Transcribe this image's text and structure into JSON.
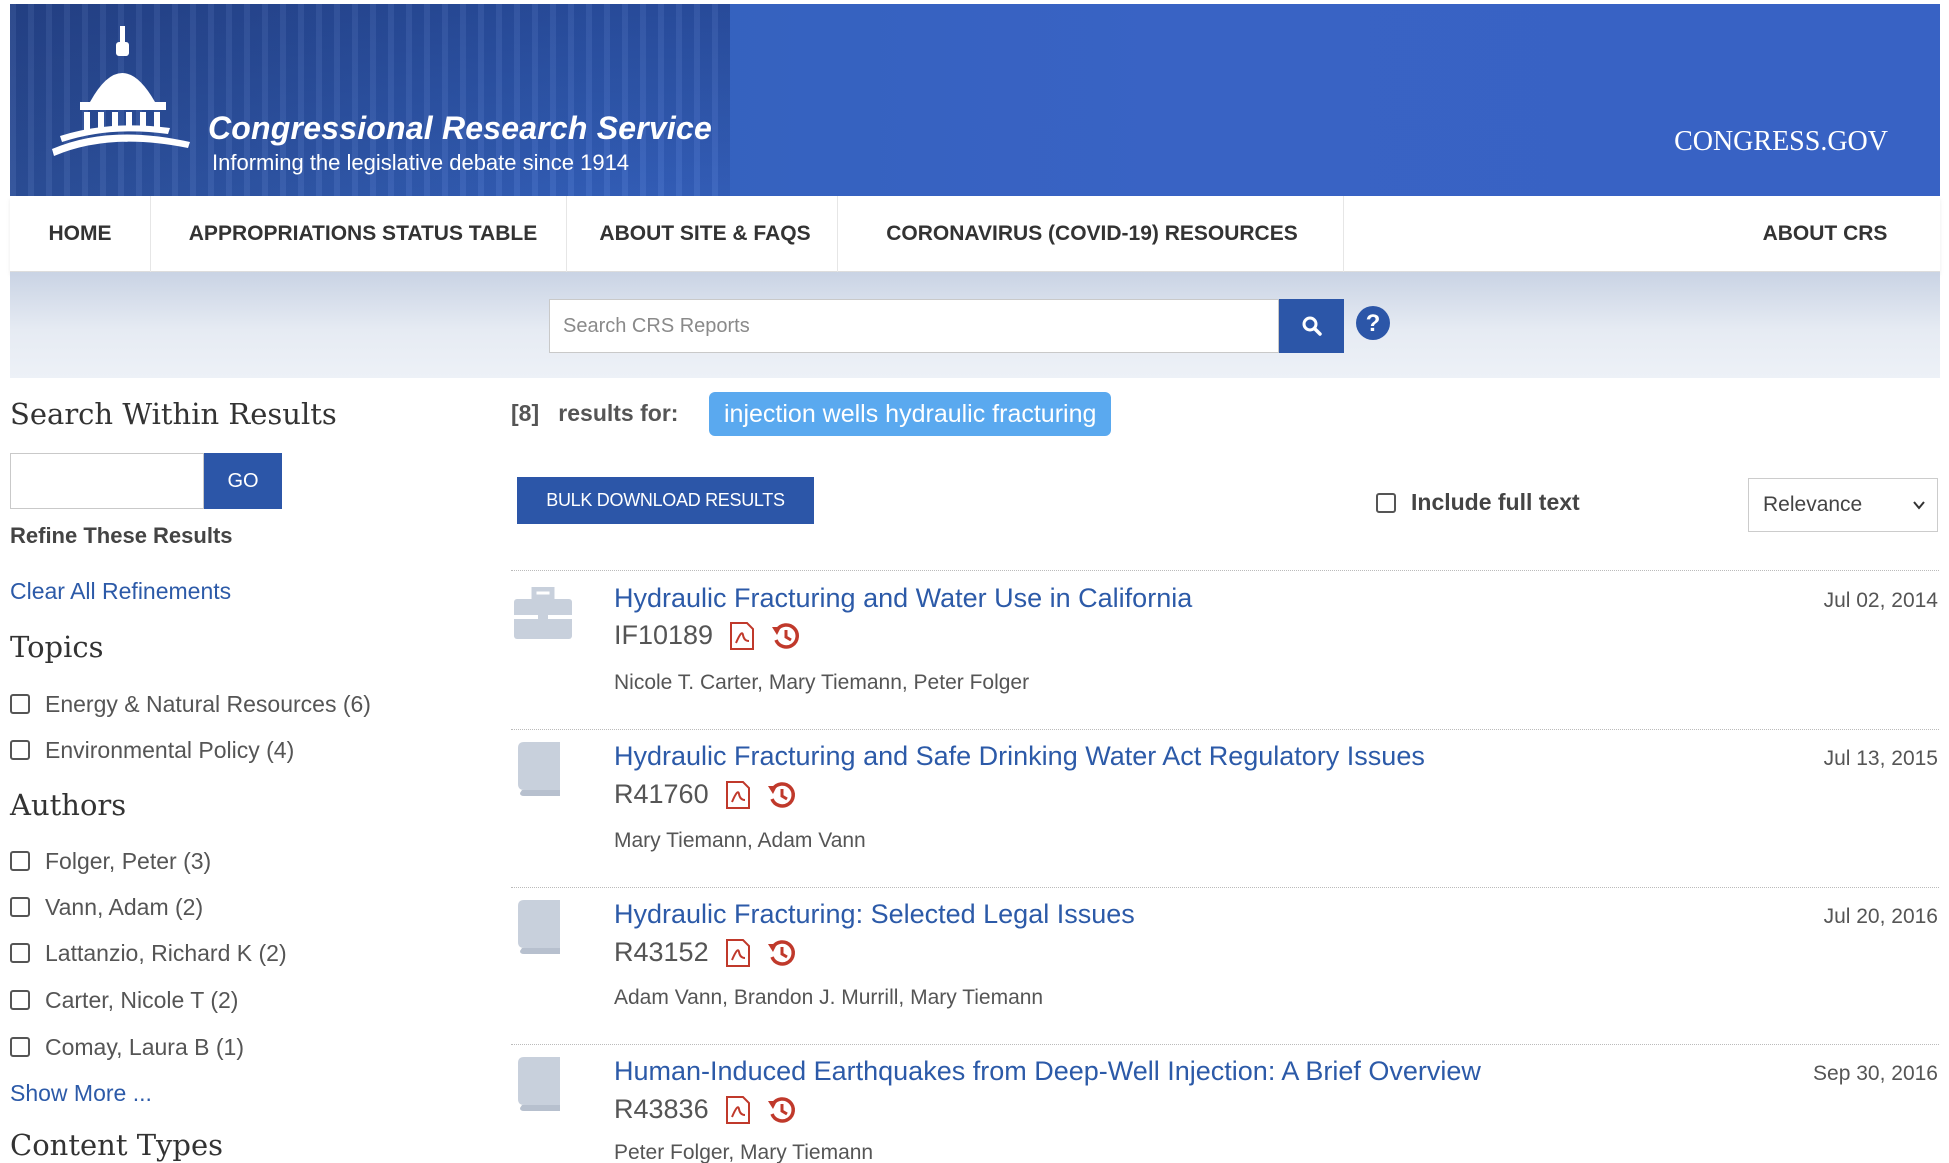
{
  "header": {
    "org_title": "Congressional Research Service",
    "tagline": "Informing the legislative debate since 1914",
    "congress_link": "CONGRESS.GOV"
  },
  "nav": {
    "items": [
      {
        "label": "HOME"
      },
      {
        "label": "APPROPRIATIONS STATUS TABLE"
      },
      {
        "label": "ABOUT SITE & FAQS"
      },
      {
        "label": "CORONAVIRUS (COVID-19) RESOURCES"
      },
      {
        "label": "ABOUT CRS"
      }
    ]
  },
  "search": {
    "placeholder": "Search CRS Reports",
    "button_icon": "search-icon",
    "help_icon": "help-icon"
  },
  "sidebar": {
    "within_heading": "Search Within Results",
    "go_label": "GO",
    "refine_label": "Refine These Results",
    "clear_label": "Clear All Refinements",
    "topics_heading": "Topics",
    "topics": [
      {
        "label": "Energy & Natural Resources (6)"
      },
      {
        "label": "Environmental Policy (4)"
      }
    ],
    "authors_heading": "Authors",
    "authors": [
      {
        "label": "Folger, Peter (3)"
      },
      {
        "label": "Vann, Adam (2)"
      },
      {
        "label": "Lattanzio, Richard K (2)"
      },
      {
        "label": "Carter, Nicole T (2)"
      },
      {
        "label": "Comay, Laura B (1)"
      }
    ],
    "show_more": "Show More ...",
    "content_types_heading": "Content Types"
  },
  "results": {
    "count": "[8]",
    "results_for": "results for:",
    "query": "injection wells hydraulic fracturing",
    "bulk_download": "BULK DOWNLOAD RESULTS",
    "include_full_text": "Include full text",
    "sort_value": "Relevance",
    "colors": {
      "link": "#2c5aa8",
      "button": "#2c56a8",
      "pill": "#5aa9ef",
      "pdf": "#c0392b"
    },
    "items": [
      {
        "icon": "briefcase-icon",
        "title": "Hydraulic Fracturing and Water Use in California",
        "id": "IF10189",
        "date": "Jul 02, 2014",
        "authors": "Nicole T. Carter,  Mary Tiemann,  Peter Folger"
      },
      {
        "icon": "book-icon",
        "title": "Hydraulic Fracturing and Safe Drinking Water Act Regulatory Issues",
        "id": "R41760",
        "date": "Jul 13, 2015",
        "authors": "Mary Tiemann,  Adam Vann"
      },
      {
        "icon": "book-icon",
        "title": "Hydraulic Fracturing: Selected Legal Issues",
        "id": "R43152",
        "date": "Jul 20, 2016",
        "authors": "Adam Vann,  Brandon J. Murrill,  Mary Tiemann"
      },
      {
        "icon": "book-icon",
        "title": "Human-Induced Earthquakes from Deep-Well Injection: A Brief Overview",
        "id": "R43836",
        "date": "Sep 30, 2016",
        "authors": "Peter Folger,  Mary Tiemann"
      }
    ]
  }
}
